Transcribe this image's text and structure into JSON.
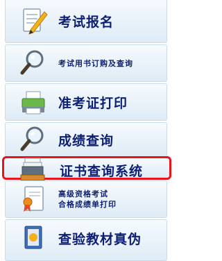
{
  "menu": {
    "items": [
      {
        "label": "考试报名",
        "icon": "notepad-pencil-icon"
      },
      {
        "label": "考试用书订购及查询",
        "icon": "magnifier-icon"
      },
      {
        "label": "准考证打印",
        "icon": "printer-icon"
      },
      {
        "label": "成绩查询",
        "icon": "magnifier-icon"
      },
      {
        "label": "证书查询系统",
        "icon": "file-tray-icon",
        "highlighted": true
      },
      {
        "label_line1": "高级资格考试",
        "label_line2": "合格成绩单打印",
        "icon": "certificate-ribbon-icon"
      },
      {
        "label": "查验教材真伪",
        "icon": "book-check-icon"
      }
    ]
  },
  "colors": {
    "label_text": "#0d1f73",
    "highlight_border": "#e8141c",
    "item_border": "#c9dbe9"
  }
}
